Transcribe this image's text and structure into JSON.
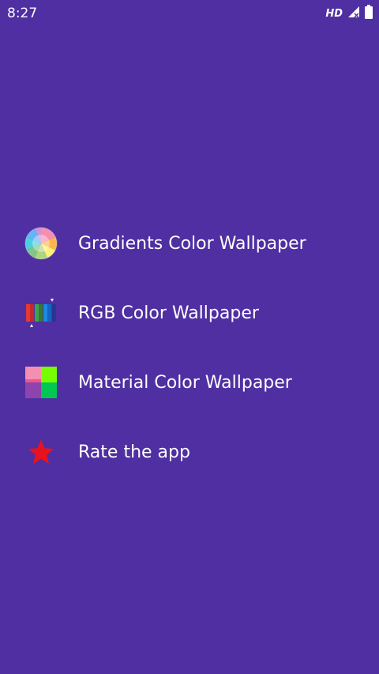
{
  "status_bar": {
    "time": "8:27",
    "network_label": "HD",
    "icons": [
      "signal-icon",
      "battery-icon"
    ]
  },
  "menu": {
    "items": [
      {
        "label": "Gradients Color Wallpaper",
        "icon": "color-wheel-icon"
      },
      {
        "label": "RGB Color Wallpaper",
        "icon": "rgb-bars-icon"
      },
      {
        "label": "Material Color Wallpaper",
        "icon": "material-squares-icon"
      },
      {
        "label": "Rate the app",
        "icon": "star-icon"
      }
    ]
  },
  "colors": {
    "background": "#4f2fa2",
    "text": "#ffffff",
    "star": "#e8121e"
  }
}
